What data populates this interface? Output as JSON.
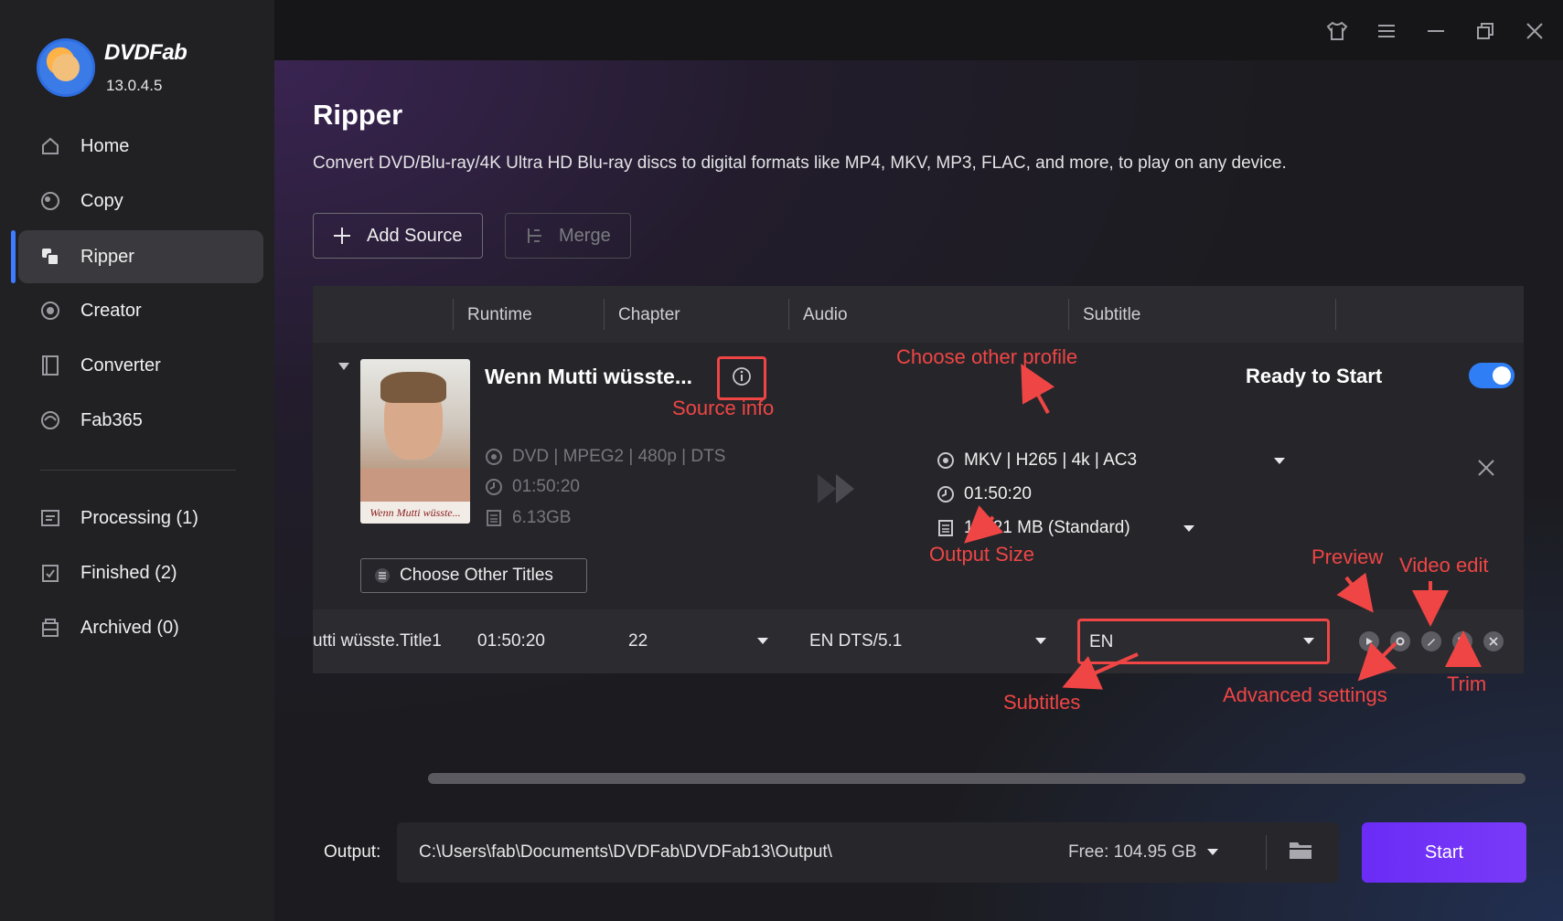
{
  "app": {
    "brand": "DVDFab",
    "version": "13.0.4.5"
  },
  "sidebar": {
    "nav": [
      {
        "label": "Home",
        "icon": "home-icon"
      },
      {
        "label": "Copy",
        "icon": "copy-icon"
      },
      {
        "label": "Ripper",
        "icon": "ripper-icon",
        "active": true
      },
      {
        "label": "Creator",
        "icon": "creator-icon"
      },
      {
        "label": "Converter",
        "icon": "converter-icon"
      },
      {
        "label": "Fab365",
        "icon": "fab365-icon"
      }
    ],
    "queue": [
      {
        "label": "Processing (1)",
        "icon": "processing-icon"
      },
      {
        "label": "Finished (2)",
        "icon": "finished-icon"
      },
      {
        "label": "Archived (0)",
        "icon": "archived-icon"
      }
    ]
  },
  "titlebar": {
    "icons": [
      "shirt-icon",
      "menu-icon",
      "minimize-icon",
      "restore-icon",
      "close-icon"
    ]
  },
  "main": {
    "title": "Ripper",
    "description": "Convert DVD/Blu-ray/4K Ultra HD Blu-ray discs to digital formats like MP4, MKV, MP3, FLAC, and more, to play on any device.",
    "toolbar": {
      "add_source": "Add Source",
      "merge": "Merge"
    },
    "table": {
      "headers": {
        "runtime": "Runtime",
        "chapter": "Chapter",
        "audio": "Audio",
        "subtitle": "Subtitle"
      },
      "item": {
        "title": "Wenn Mutti wüsste...",
        "thumbnail_caption": "Wenn Mutti wüsste...",
        "source": {
          "format": "DVD | MPEG2 | 480p | DTS",
          "duration": "01:50:20",
          "size": "6.13GB"
        },
        "profile": {
          "format": "MKV | H265 | 4k | AC3",
          "duration": "01:50:20",
          "size": "16021 MB (Standard)"
        },
        "status": "Ready to Start",
        "ready_enabled": true,
        "choose_titles": "Choose Other Titles"
      },
      "title_row": {
        "name": "utti wüsste.Title1",
        "runtime": "01:50:20",
        "chapter": "22",
        "audio": "EN  DTS/5.1",
        "subtitle": "EN"
      }
    },
    "annotations": {
      "source_info": "Source info",
      "choose_profile": "Choose other profile",
      "output_size": "Output Size",
      "subtitles": "Subtitles",
      "preview": "Preview",
      "video_edit": "Video edit",
      "advanced_settings": "Advanced settings",
      "trim": "Trim"
    },
    "annotation_color": "#f04545",
    "output": {
      "label": "Output:",
      "path": "C:\\Users\\fab\\Documents\\DVDFab\\DVDFab13\\Output\\",
      "free": "Free: 104.95 GB"
    },
    "start_label": "Start",
    "accent_color": "#6a2cf6"
  }
}
